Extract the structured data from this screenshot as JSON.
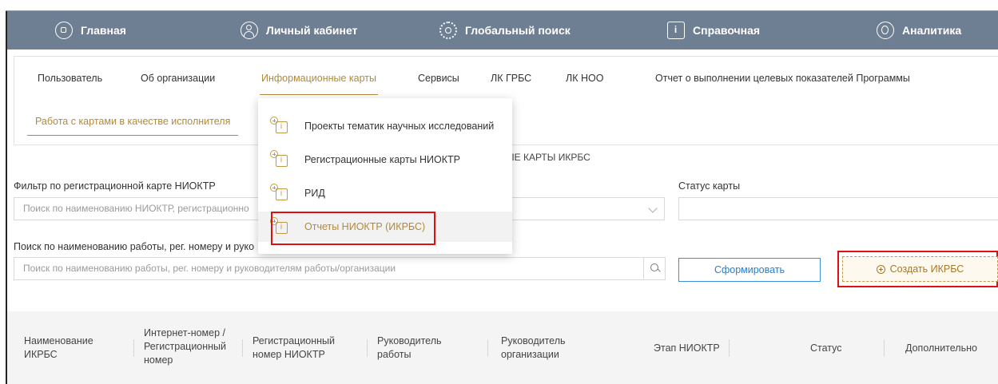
{
  "top_nav": {
    "items": [
      {
        "label": "Главная",
        "icon": "home-square-icon"
      },
      {
        "label": "Личный кабинет",
        "icon": "user-icon"
      },
      {
        "label": "Глобальный поиск",
        "icon": "gear-search-icon"
      },
      {
        "label": "Справочная",
        "icon": "info-icon"
      },
      {
        "label": "Аналитика",
        "icon": "analytics-icon"
      }
    ],
    "bg_color": "#6f7f93"
  },
  "menu": {
    "items": [
      "Пользователь",
      "Об организации",
      "Информационные карты",
      "Сервисы",
      "ЛК ГРБС",
      "ЛК НОО",
      "Отчет о выполнении целевых показателей Программы"
    ],
    "active": "Информационные карты",
    "accent_color": "#b08a3c"
  },
  "sub_tab": "Работа с картами в качестве исполнителя",
  "partial_title": "ЫЕ КАРТЫ ИКРБС",
  "filters": {
    "niokr_label": "Фильтр по регистрационной карте НИОКТР",
    "niokr_placeholder": "Поиск по наименованию НИОКТР, регистрационно",
    "status_label": "Статус карты",
    "status_value": "",
    "search_label": "Поиск по наименованию работы, рег. номеру и руко",
    "search_placeholder": "Поиск по наименованию работы, рег. номеру и руководителям работы/организации"
  },
  "buttons": {
    "form": "Сформировать",
    "create": "Создать ИКРБС"
  },
  "table": {
    "headers": [
      "Наименование ИКРБС",
      "Интернет-номер / Регистрационный номер",
      "Регистрационный номер НИОКТР",
      "Руководитель работы",
      "Руководитель организации",
      "Этап НИОКТР",
      "Статус",
      "Дополнительно"
    ]
  },
  "dropdown": {
    "items": [
      "Проекты тематик научных исследований",
      "Регистрационные карты НИОКТР",
      "РИД",
      "Отчеты НИОКТР (ИКРБС)"
    ],
    "highlighted": "Отчеты НИОКТР (ИКРБС)"
  },
  "colors": {
    "highlight_red": "#e01010",
    "button_blue": "#3b8fd6"
  }
}
